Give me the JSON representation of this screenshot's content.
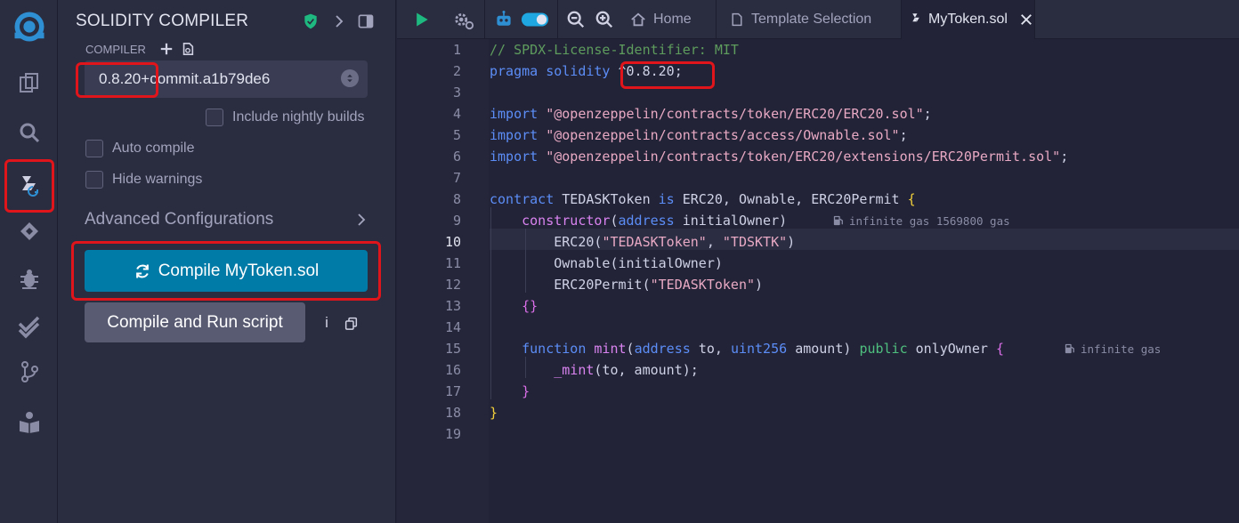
{
  "panel": {
    "title": "SOLIDITY COMPILER",
    "compiler_label": "COMPILER",
    "compiler_version": "0.8.20+commit.a1b79de6",
    "include_nightly": "Include nightly builds",
    "auto_compile": "Auto compile",
    "hide_warnings": "Hide warnings",
    "advanced": "Advanced Configurations",
    "compile_button": "Compile MyToken.sol",
    "run_button": "Compile and Run script",
    "info": "i"
  },
  "tabs": {
    "home": "Home",
    "template": "Template Selection",
    "file": "MyToken.sol"
  },
  "editor": {
    "line_numbers": [
      "1",
      "2",
      "3",
      "4",
      "5",
      "6",
      "7",
      "8",
      "9",
      "10",
      "11",
      "12",
      "13",
      "14",
      "15",
      "16",
      "17",
      "18",
      "19"
    ],
    "l1": "// SPDX-License-Identifier: MIT",
    "l2_kw": "pragma solidity",
    "l2_ver": "^0.8.20",
    "l4_path": "\"@openzeppelin/contracts/token/ERC20/ERC20.sol\"",
    "l5_path": "\"@openzeppelin/contracts/access/Ownable.sol\"",
    "l6_path": "\"@openzeppelin/contracts/token/ERC20/extensions/ERC20Permit.sol\"",
    "import_kw": "import",
    "l8_contract": "contract",
    "l8_name": "TEDASKToken",
    "l8_is": "is",
    "l8_bases": "ERC20, Ownable, ERC20Permit",
    "l9_ctor": "constructor",
    "l9_param_type": "address",
    "l9_param": "initialOwner",
    "l9_gas": "infinite gas 1569800 gas",
    "l10_fn": "ERC20",
    "l10_a1": "\"TEDASKToken\"",
    "l10_a2": "\"TDSKTK\"",
    "l11": "Ownable(initialOwner)",
    "l12_fn": "ERC20Permit",
    "l12_a1": "\"TEDASKToken\"",
    "l13": "{}",
    "l15_function": "function",
    "l15_name": "mint",
    "l15_t1": "address",
    "l15_p1": "to",
    "l15_t2": "uint256",
    "l15_p2": "amount",
    "l15_public": "public",
    "l15_mod": "onlyOwner",
    "l15_gas": "infinite gas",
    "l16_fn": "_mint",
    "l16_args": "to, amount",
    "l17": "}",
    "l18": "}"
  },
  "colors": {
    "accent": "#007aa6",
    "highlight": "#e0141b",
    "play": "#1eb980"
  }
}
